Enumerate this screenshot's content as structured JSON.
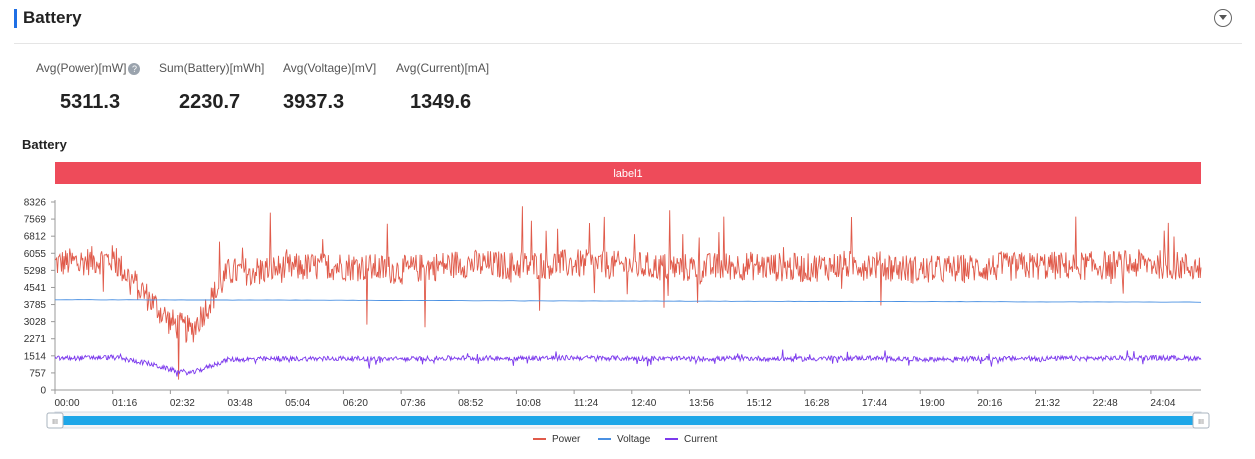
{
  "header": {
    "title": "Battery",
    "collapse_icon": "chevron-down-icon"
  },
  "metrics": [
    {
      "label": "Avg(Power)[mW]",
      "value": "5311.3",
      "help_icon": "?"
    },
    {
      "label": "Sum(Battery)[mWh]",
      "value": "2230.7"
    },
    {
      "label": "Avg(Voltage)[mV]",
      "value": "3937.3"
    },
    {
      "label": "Avg(Current)[mA]",
      "value": "1349.6"
    }
  ],
  "chart_data": {
    "type": "line",
    "title": "Battery",
    "band_label": "label1",
    "band_color": "#ee4b5a",
    "y_ticks": [
      "8326",
      "7569",
      "6812",
      "6055",
      "5298",
      "4541",
      "3785",
      "3028",
      "2271",
      "1514",
      "757",
      "0"
    ],
    "ylim": [
      0,
      8326
    ],
    "x_ticks": [
      "00:00",
      "01:16",
      "02:32",
      "03:48",
      "05:04",
      "06:20",
      "07:36",
      "08:52",
      "10:08",
      "11:24",
      "12:40",
      "13:56",
      "15:12",
      "16:28",
      "17:44",
      "19:00",
      "20:16",
      "21:32",
      "22:48",
      "24:04"
    ],
    "xlim": [
      "00:00",
      "25:10"
    ],
    "grid": false,
    "legend_position": "bottom-center",
    "series": [
      {
        "name": "Power",
        "color": "#e05a4a",
        "x": [
          "00:00",
          "01:16",
          "02:00",
          "02:32",
          "03:00",
          "03:48",
          "05:04",
          "06:20",
          "07:36",
          "08:52",
          "10:08",
          "11:24",
          "12:40",
          "13:56",
          "15:12",
          "16:28",
          "17:44",
          "19:00",
          "20:16",
          "21:32",
          "22:48",
          "24:04",
          "25:10"
        ],
        "y": [
          5600,
          5800,
          4200,
          3000,
          2600,
          5200,
          5400,
          5500,
          5300,
          5600,
          5500,
          5600,
          5500,
          5400,
          5500,
          5400,
          5600,
          5300,
          5400,
          5500,
          5500,
          5600,
          5400
        ]
      },
      {
        "name": "Voltage",
        "color": "#4a90e2",
        "x": [
          "00:00",
          "05:04",
          "10:08",
          "15:12",
          "20:16",
          "25:10"
        ],
        "y": [
          4000,
          3980,
          3950,
          3930,
          3910,
          3890
        ]
      },
      {
        "name": "Current",
        "color": "#7c3aed",
        "x": [
          "00:00",
          "01:16",
          "02:00",
          "02:32",
          "03:00",
          "03:48",
          "05:04",
          "06:20",
          "07:36",
          "08:52",
          "10:08",
          "11:24",
          "12:40",
          "13:56",
          "15:12",
          "16:28",
          "17:44",
          "19:00",
          "20:16",
          "21:32",
          "22:48",
          "24:04",
          "25:10"
        ],
        "y": [
          1400,
          1450,
          1200,
          900,
          750,
          1350,
          1380,
          1400,
          1370,
          1420,
          1400,
          1430,
          1400,
          1380,
          1400,
          1380,
          1420,
          1360,
          1380,
          1400,
          1400,
          1430,
          1400
        ]
      }
    ],
    "zoom_slider": {
      "start": 0,
      "end": 1,
      "handle_glyph": "III",
      "color": "#1ea7e8"
    }
  }
}
